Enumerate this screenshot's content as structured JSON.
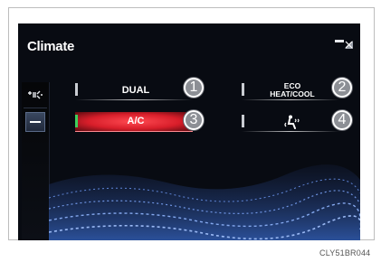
{
  "screen": {
    "title": "Climate"
  },
  "sidebar": {
    "items": [
      {
        "icon": "fan-mode-icon",
        "active": false
      },
      {
        "icon": "dash-icon",
        "active": true
      }
    ]
  },
  "buttons": [
    {
      "lines": [
        "DUAL"
      ],
      "indicator": "off",
      "number": "1"
    },
    {
      "lines": [
        "ECO",
        "HEAT/COOL"
      ],
      "indicator": "off",
      "number": "2"
    },
    {
      "lines": [
        "A/C"
      ],
      "indicator": "on",
      "number": "3"
    },
    {
      "icon": "seat-air-icon",
      "indicator": "off",
      "number": "4"
    }
  ],
  "caption": "CLY51BR044",
  "colors": {
    "screen_bg": "#080b12",
    "ac_active": "#e0202c",
    "indicator_on": "#3ecf5c",
    "wave": "#2a4a8a"
  }
}
